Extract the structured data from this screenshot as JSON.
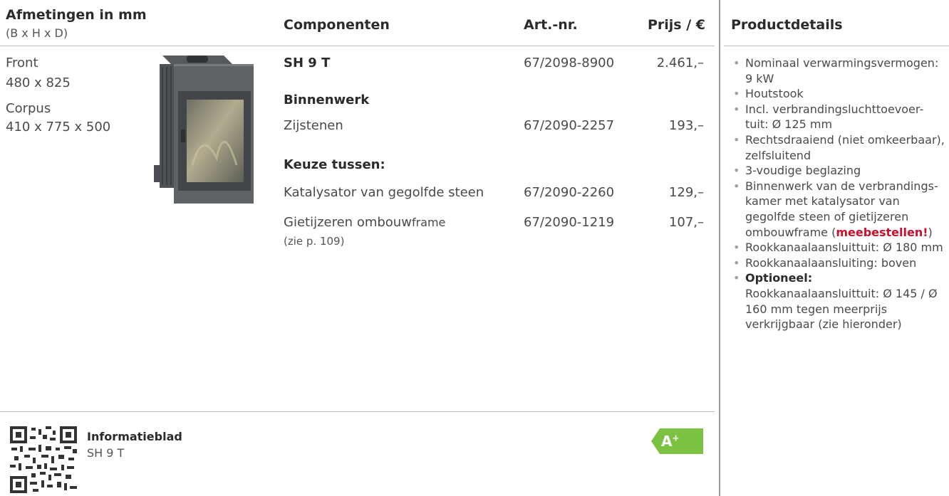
{
  "header": {
    "dimensions_title": "Afmetingen in mm",
    "dimensions_sub": "(B x H x D)",
    "components": "Componenten",
    "art_nr": "Art.-nr.",
    "price": "Prijs / €",
    "details": "Productdetails"
  },
  "dimensions": {
    "front_label": "Front",
    "front_value": "480 x 825",
    "corpus_label": "Corpus",
    "corpus_value": "410 x 775 x 500"
  },
  "rows": {
    "main": {
      "name": "SH 9 T",
      "art": "67/2098-8900",
      "price": "2.461,–"
    },
    "section_inner": "Binnenwerk",
    "side_stones": {
      "name": "Zijstenen",
      "art": "67/2090-2257",
      "price": "193,–"
    },
    "section_choice": "Keuze tussen:",
    "catalyst": {
      "name": "Katalysator van gegolfde steen",
      "art": "67/2090-2260",
      "price": "129,–"
    },
    "frame": {
      "name_main": "Gietijzeren ombouw",
      "name_suffix": "frame",
      "note": "(zie p. 109)",
      "art": "67/2090-1219",
      "price": "107,–"
    }
  },
  "details": [
    {
      "text": "Nominaal verwarmingsvermogen: 9 kW"
    },
    {
      "text": "Houtstook"
    },
    {
      "text": "Incl. verbrandingsluchttoevoer-tuit: Ø 125 mm"
    },
    {
      "text": "Rechtsdraaiend (niet omkeerbaar), zelfsluitend"
    },
    {
      "text": "3-voudige beglazing"
    },
    {
      "text_before": "Binnenwerk van de verbrandings-kamer met katalysator van gegolfde steen of gietijzeren ombouwframe (",
      "highlight": "meebestellen!",
      "text_after": ")"
    },
    {
      "text": "Rookkanaalaansluittuit: Ø 180 mm"
    },
    {
      "text": "Rookkanaalaansluiting: boven"
    },
    {
      "label": "Optioneel:",
      "text": "Rookkanaalaansluittuit: Ø 145 / Ø 160 mm tegen meerprijs verkrijgbaar (zie hieronder)"
    }
  ],
  "footer": {
    "info_title": "Informatieblad",
    "info_product": "SH 9 T",
    "energy_class": "A",
    "energy_sup": "+"
  },
  "colors": {
    "energy_green": "#7cc242",
    "highlight_red": "#c8102e"
  }
}
